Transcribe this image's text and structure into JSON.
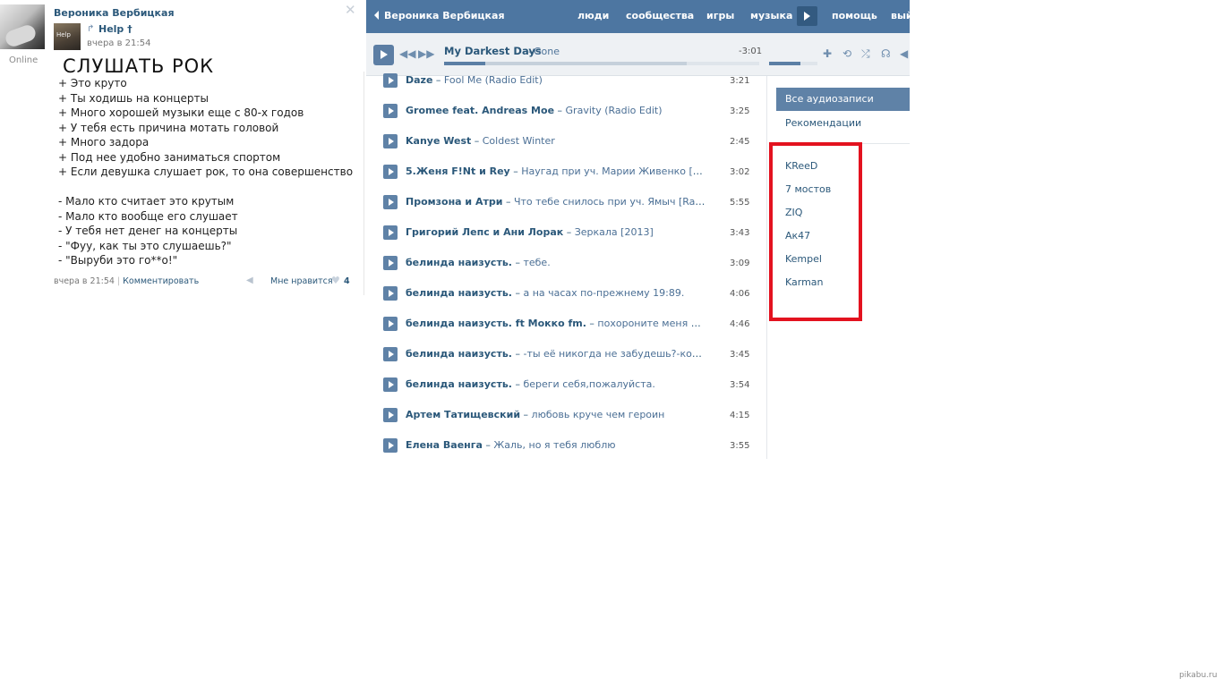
{
  "post": {
    "author_name": "Вероника Вербицкая",
    "online_status": "Online",
    "repost": {
      "group_name": "Help †",
      "thumb_label": "Help",
      "time": "вчера в 21:54"
    },
    "title": "СЛУШАТЬ РОК",
    "lines": [
      "+ Это круто",
      "+ Ты ходишь на концерты",
      "+ Много хорошей музыки еще с 80-х годов",
      "+ У тебя есть причина мотать головой",
      "+ Много задора",
      "+ Под нее удобно заниматься спортом",
      "+ Если девушка слушает рок, то она совершенство",
      "",
      "- Мало кто считает это крутым",
      "- Мало кто вообще его слушает",
      "- У тебя нет денег на концерты",
      "- \"Фуу, как ты это слушаешь?\"",
      "- \"Выруби это го**о!\""
    ],
    "footer": {
      "time": "вчера в 21:54",
      "separator": "|",
      "comment_label": "Комментировать",
      "like_label": "Мне нравится",
      "like_count": "4"
    }
  },
  "topbar": {
    "profile_name": "Вероника Вербицкая",
    "nav": {
      "people": "люди",
      "communities": "сообщества",
      "games": "игры",
      "music": "музыка",
      "help": "помощь",
      "exit": "вый"
    }
  },
  "player": {
    "artist": "My Darkest Days",
    "separator": "–",
    "title": "Gone",
    "time_left": "-3:01",
    "progress_fraction": 0.13,
    "buffer_fraction": 0.77,
    "volume_fraction": 0.65,
    "icons": [
      "play-icon",
      "prev-icon",
      "next-icon",
      "add-icon",
      "repeat-icon",
      "shuffle-icon",
      "headphones-icon",
      "broadcast-icon"
    ]
  },
  "tracks": [
    {
      "artist": "Daze",
      "title": "Fool Me (Radio Edit)",
      "duration": "3:21"
    },
    {
      "artist": "Gromee feat. Andreas Moe",
      "title": "Gravity (Radio Edit)",
      "duration": "3:25"
    },
    {
      "artist": "Kanye West",
      "title": "Coldest Winter",
      "duration": "2:45"
    },
    {
      "artist": "5.Женя F!Nt и Rey",
      "title": "Наугад при уч. Марии Живенко [ \"Наугад\"]",
      "duration": "3:02"
    },
    {
      "artist": "Промзона и Атри",
      "title": "Что тебе снилось при уч. Ямыч [RapBest.ru]",
      "duration": "5:55"
    },
    {
      "artist": "Григорий Лепс и Ани Лорак",
      "title": "Зеркала [2013]",
      "duration": "3:43"
    },
    {
      "artist": "белинда наизусть.",
      "title": "тебе.",
      "duration": "3:09"
    },
    {
      "artist": "белинда наизусть.",
      "title": "а на часах по-прежнему 19:89.",
      "duration": "4:06"
    },
    {
      "artist": "белинда наизусть. ft Мокко fm.",
      "title": "похороните меня за плинтусом.",
      "duration": "4:46"
    },
    {
      "artist": "белинда наизусть.",
      "title": "-ты её никогда не забудешь?-кого?",
      "duration": "3:45"
    },
    {
      "artist": "белинда наизусть.",
      "title": "береги себя,пожалуйста.",
      "duration": "3:54"
    },
    {
      "artist": "Артем Татищевский",
      "title": "любовь круче чем героин",
      "duration": "4:15"
    },
    {
      "artist": "Елена Ваенга",
      "title": "Жаль, но я тебя люблю",
      "duration": "3:55"
    }
  ],
  "track_separator": "–",
  "side_menu": {
    "all_audio": "Все аудиозаписи",
    "recommendations": "Рекомендации",
    "artists": [
      "KReeD",
      "7 мостов",
      "ZIQ",
      "Ак47",
      "Kempel",
      "Karman"
    ],
    "highlight_color": "#e3121f"
  },
  "colors": {
    "brand_blue": "#4d76a1",
    "link_blue": "#2b587a",
    "highlight_red": "#e3121f"
  },
  "watermark": "pikabu.ru"
}
